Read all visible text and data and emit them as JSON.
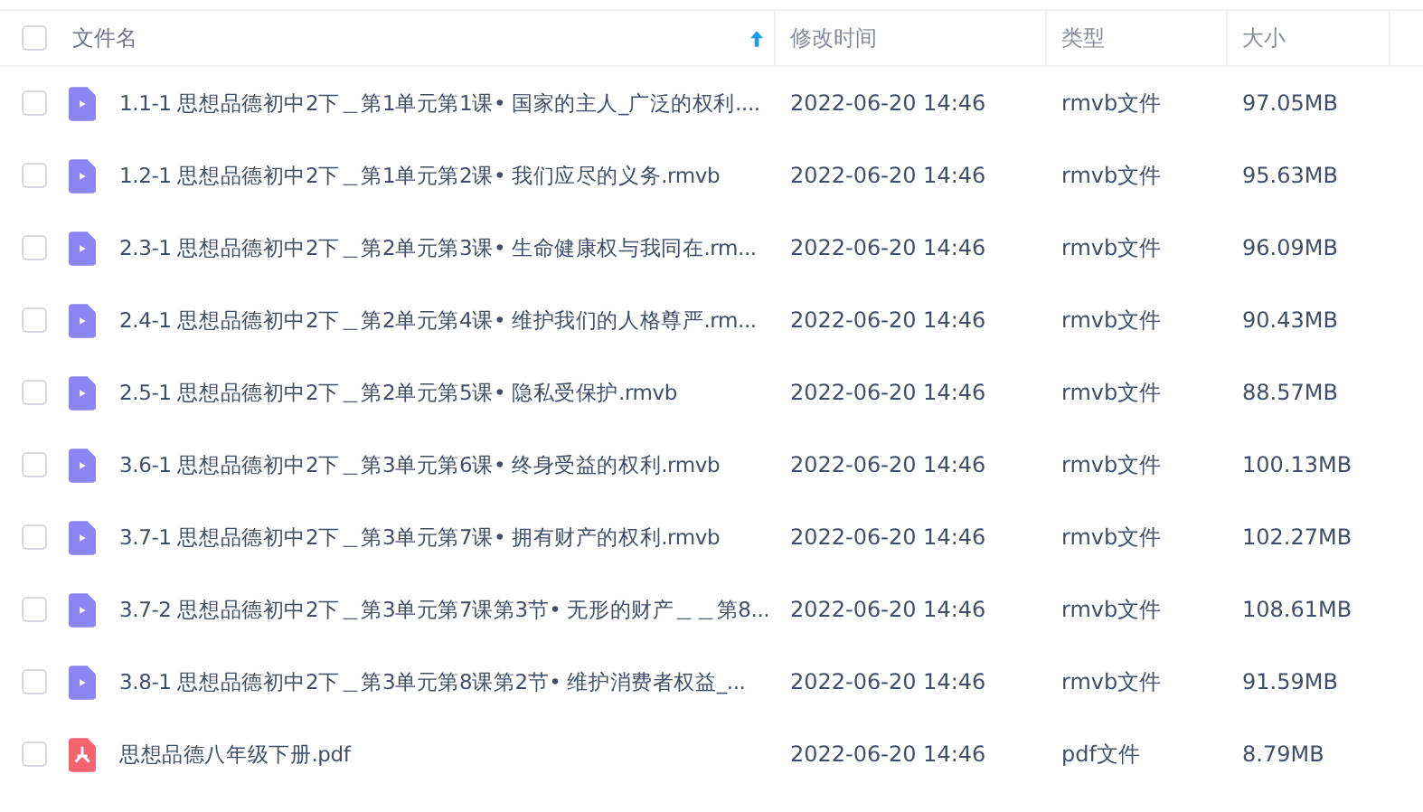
{
  "header": {
    "checked": false,
    "columns": [
      {
        "label": "文件名",
        "sorted": true
      },
      {
        "label": "修改时间",
        "sorted": false
      },
      {
        "label": "类型",
        "sorted": false
      },
      {
        "label": "大小",
        "sorted": false
      }
    ]
  },
  "rows": [
    {
      "kind": "video",
      "checked": false,
      "name": "1.1-1 思想品德初中2下＿第1单元第1课• 国家的主人_广泛的权利....",
      "modified": "2022-06-20 14:46",
      "type": "rmvb文件",
      "size": "97.05MB"
    },
    {
      "kind": "video",
      "checked": false,
      "name": "1.2-1 思想品德初中2下＿第1单元第2课• 我们应尽的义务.rmvb",
      "modified": "2022-06-20 14:46",
      "type": "rmvb文件",
      "size": "95.63MB"
    },
    {
      "kind": "video",
      "checked": false,
      "name": "2.3-1 思想品德初中2下＿第2单元第3课• 生命健康权与我同在.rm...",
      "modified": "2022-06-20 14:46",
      "type": "rmvb文件",
      "size": "96.09MB"
    },
    {
      "kind": "video",
      "checked": false,
      "name": "2.4-1 思想品德初中2下＿第2单元第4课• 维护我们的人格尊严.rm...",
      "modified": "2022-06-20 14:46",
      "type": "rmvb文件",
      "size": "90.43MB"
    },
    {
      "kind": "video",
      "checked": false,
      "name": "2.5-1 思想品德初中2下＿第2单元第5课• 隐私受保护.rmvb",
      "modified": "2022-06-20 14:46",
      "type": "rmvb文件",
      "size": "88.57MB"
    },
    {
      "kind": "video",
      "checked": false,
      "name": "3.6-1 思想品德初中2下＿第3单元第6课• 终身受益的权利.rmvb",
      "modified": "2022-06-20 14:46",
      "type": "rmvb文件",
      "size": "100.13MB"
    },
    {
      "kind": "video",
      "checked": false,
      "name": "3.7-1 思想品德初中2下＿第3单元第7课• 拥有财产的权利.rmvb",
      "modified": "2022-06-20 14:46",
      "type": "rmvb文件",
      "size": "102.27MB"
    },
    {
      "kind": "video",
      "checked": false,
      "name": "3.7-2 思想品德初中2下＿第3单元第7课第3节• 无形的财产＿＿第8...",
      "modified": "2022-06-20 14:46",
      "type": "rmvb文件",
      "size": "108.61MB"
    },
    {
      "kind": "video",
      "checked": false,
      "name": "3.8-1 思想品德初中2下＿第3单元第8课第2节• 维护消费者权益_...",
      "modified": "2022-06-20 14:46",
      "type": "rmvb文件",
      "size": "91.59MB"
    },
    {
      "kind": "pdf",
      "checked": false,
      "name": "思想品德八年级下册.pdf",
      "modified": "2022-06-20 14:46",
      "type": "pdf文件",
      "size": "8.79MB"
    }
  ]
}
